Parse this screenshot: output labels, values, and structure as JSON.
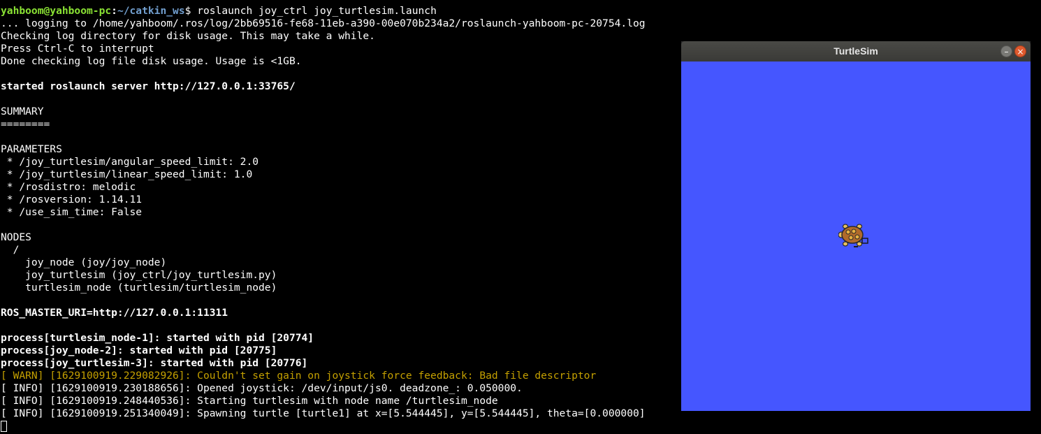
{
  "terminal": {
    "prompt": {
      "user_host": "yahboom@yahboom-pc",
      "separator": ":",
      "path": "~/catkin_ws",
      "symbol": "$",
      "command": " roslaunch joy_ctrl joy_turtlesim.launch"
    },
    "lines": [
      "... logging to /home/yahboom/.ros/log/2bb69516-fe68-11eb-a390-00e070b234a2/roslaunch-yahboom-pc-20754.log",
      "Checking log directory for disk usage. This may take a while.",
      "Press Ctrl-C to interrupt",
      "Done checking log file disk usage. Usage is <1GB.",
      "",
      "started roslaunch server http://127.0.0.1:33765/",
      "",
      "SUMMARY",
      "========",
      "",
      "PARAMETERS",
      " * /joy_turtlesim/angular_speed_limit: 2.0",
      " * /joy_turtlesim/linear_speed_limit: 1.0",
      " * /rosdistro: melodic",
      " * /rosversion: 1.14.11",
      " * /use_sim_time: False",
      "",
      "NODES",
      "  /",
      "    joy_node (joy/joy_node)",
      "    joy_turtlesim (joy_ctrl/joy_turtlesim.py)",
      "    turtlesim_node (turtlesim/turtlesim_node)",
      "",
      "ROS_MASTER_URI=http://127.0.0.1:11311",
      "",
      "process[turtlesim_node-1]: started with pid [20774]",
      "process[joy_node-2]: started with pid [20775]",
      "process[joy_turtlesim-3]: started with pid [20776]",
      "[ WARN] [1629100919.229082926]: Couldn't set gain on joystick force feedback: Bad file descriptor",
      "[ INFO] [1629100919.230188656]: Opened joystick: /dev/input/js0. deadzone_: 0.050000.",
      "[ INFO] [1629100919.248440536]: Starting turtlesim with node name /turtlesim_node",
      "[ INFO] [1629100919.251340049]: Spawning turtle [turtle1] at x=[5.544445], y=[5.544445], theta=[0.000000]"
    ]
  },
  "turtlesim": {
    "title": "TurtleSim",
    "minimize_glyph": "–",
    "close_glyph": "×",
    "background_color": "#4556ff"
  },
  "colors": {
    "terminal_bg": "#000000",
    "prompt_user": "#8ae234",
    "prompt_path": "#729fcf",
    "warn_text": "#c4a000",
    "titlebar": "#3f3f3c",
    "close_button": "#e05a2e"
  },
  "icons": {
    "turtle": "turtle-icon",
    "minimize": "minimize-icon",
    "close": "close-icon"
  }
}
